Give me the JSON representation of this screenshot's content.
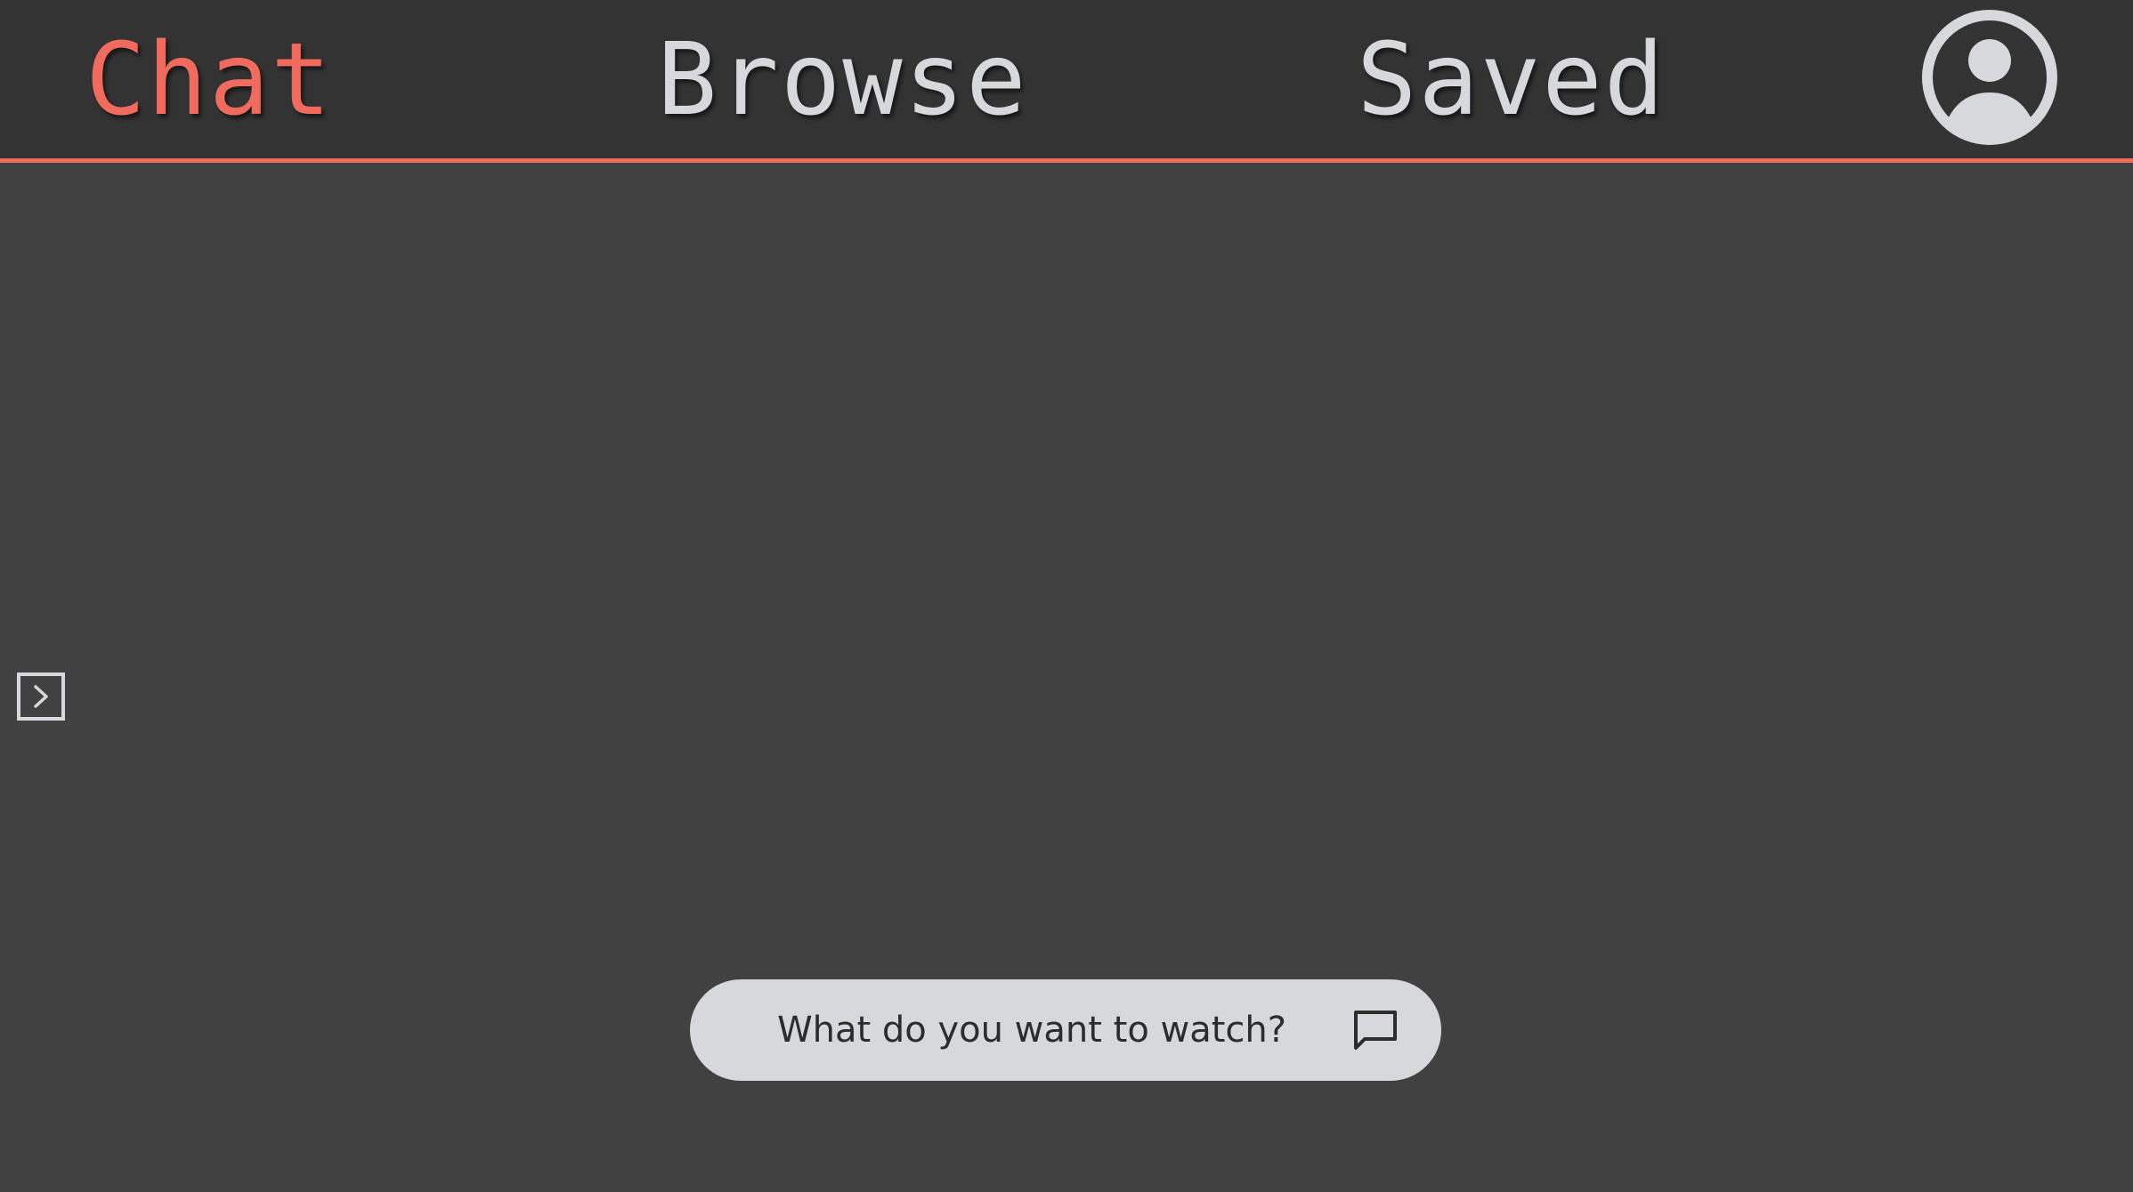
{
  "nav": {
    "tabs": [
      {
        "label": "Chat",
        "active": true
      },
      {
        "label": "Browse",
        "active": false
      },
      {
        "label": "Saved",
        "active": false
      }
    ],
    "profile_icon": "user-circle-icon"
  },
  "sidebar_toggle": {
    "icon": "chevron-right-box-icon"
  },
  "chat": {
    "input_placeholder": "What do you want to watch?",
    "input_value": "",
    "send_icon": "message-square-icon"
  },
  "colors": {
    "accent": "#f06a5e",
    "background": "#414141",
    "topbar": "#333333",
    "foreground": "#d6d8db"
  }
}
